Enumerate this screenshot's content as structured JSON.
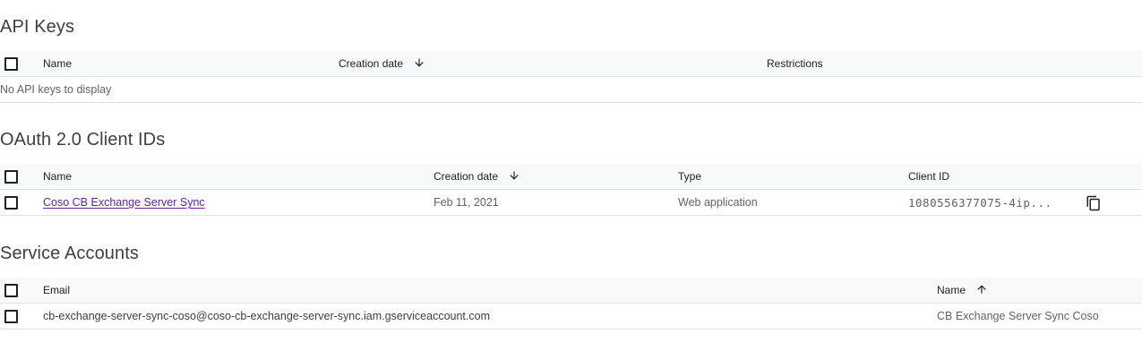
{
  "api_keys": {
    "title": "API Keys",
    "columns": {
      "name": "Name",
      "creation_date": "Creation date",
      "restrictions": "Restrictions"
    },
    "empty_message": "No API keys to display"
  },
  "oauth": {
    "title": "OAuth 2.0 Client IDs",
    "columns": {
      "name": "Name",
      "creation_date": "Creation date",
      "type": "Type",
      "client_id": "Client ID"
    },
    "rows": [
      {
        "name": "Coso CB Exchange Server Sync",
        "creation_date": "Feb 11, 2021",
        "type": "Web application",
        "client_id": "1080556377075-4ip..."
      }
    ]
  },
  "service_accounts": {
    "title": "Service Accounts",
    "columns": {
      "email": "Email",
      "name": "Name"
    },
    "rows": [
      {
        "email": "cb-exchange-server-sync-coso@coso-cb-exchange-server-sync.iam.gserviceaccount.com",
        "name": "CB Exchange Server Sync Coso"
      }
    ]
  },
  "icons": {
    "sort_desc": "arrow-down-icon",
    "sort_asc": "arrow-up-icon",
    "copy": "copy-icon"
  },
  "colors": {
    "link": "#681da8",
    "header_bg": "#f8f9fa",
    "divider": "#e0e0e0",
    "text_secondary": "#5f6368"
  }
}
